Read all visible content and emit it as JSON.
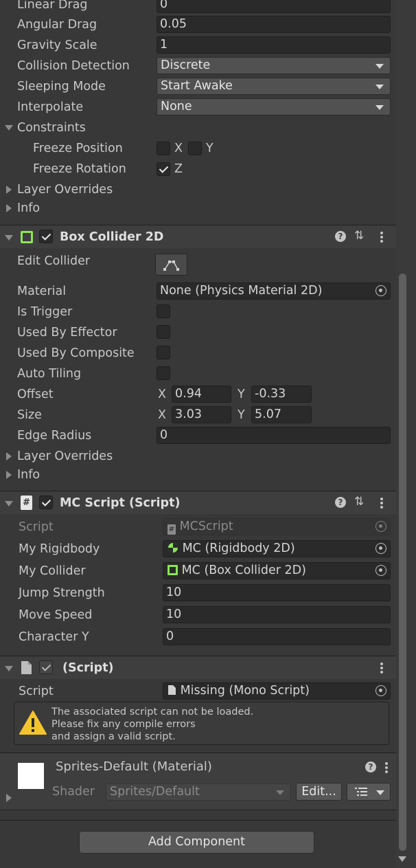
{
  "rigidbody": {
    "linear_drag": {
      "label": "Linear Drag",
      "value": "0"
    },
    "angular_drag": {
      "label": "Angular Drag",
      "value": "0.05"
    },
    "gravity_scale": {
      "label": "Gravity Scale",
      "value": "1"
    },
    "collision_detection": {
      "label": "Collision Detection",
      "value": "Discrete"
    },
    "sleeping_mode": {
      "label": "Sleeping Mode",
      "value": "Start Awake"
    },
    "interpolate": {
      "label": "Interpolate",
      "value": "None"
    },
    "constraints": {
      "label": "Constraints",
      "freeze_position": {
        "label": "Freeze Position",
        "x_label": "X",
        "y_label": "Y",
        "x": false,
        "y": false
      },
      "freeze_rotation": {
        "label": "Freeze Rotation",
        "z_label": "Z",
        "z": true
      }
    },
    "layer_overrides": "Layer Overrides",
    "info": "Info"
  },
  "box_collider": {
    "title": "Box Collider 2D",
    "enabled": true,
    "edit_collider": "Edit Collider",
    "material": {
      "label": "Material",
      "value": "None (Physics Material 2D)"
    },
    "is_trigger": {
      "label": "Is Trigger",
      "checked": false
    },
    "used_by_effector": {
      "label": "Used By Effector",
      "checked": false
    },
    "used_by_composite": {
      "label": "Used By Composite",
      "checked": false
    },
    "auto_tiling": {
      "label": "Auto Tiling",
      "checked": false
    },
    "offset": {
      "label": "Offset",
      "x_label": "X",
      "x": "0.94",
      "y_label": "Y",
      "y": "-0.33"
    },
    "size": {
      "label": "Size",
      "x_label": "X",
      "x": "3.03",
      "y_label": "Y",
      "y": "5.07"
    },
    "edge_radius": {
      "label": "Edge Radius",
      "value": "0"
    },
    "layer_overrides": "Layer Overrides",
    "info": "Info"
  },
  "mc_script": {
    "title": "MC Script (Script)",
    "enabled": true,
    "script": {
      "label": "Script",
      "value": "MCScript"
    },
    "my_rigidbody": {
      "label": "My Rigidbody",
      "value": "MC (Rigidbody 2D)"
    },
    "my_collider": {
      "label": "My Collider",
      "value": "MC (Box Collider 2D)"
    },
    "jump_strength": {
      "label": "Jump Strength",
      "value": "10"
    },
    "move_speed": {
      "label": "Move Speed",
      "value": "10"
    },
    "character_y": {
      "label": "Character Y",
      "value": "0"
    }
  },
  "missing_script": {
    "title": "(Script)",
    "script": {
      "label": "Script",
      "value": "Missing (Mono Script)"
    },
    "warning": {
      "line1": "The associated script can not be loaded.",
      "line2": "Please fix any compile errors",
      "line3": "and assign a valid script."
    }
  },
  "material": {
    "title": "Sprites-Default (Material)",
    "shader_label": "Shader",
    "shader_value": "Sprites/Default",
    "edit_button": "Edit..."
  },
  "add_component": "Add Component",
  "colors": {
    "background": "#383838",
    "header": "#3e3e3e",
    "field": "#2a2a2a",
    "collider_green": "#8de35a",
    "warning_yellow": "#f4c430"
  }
}
